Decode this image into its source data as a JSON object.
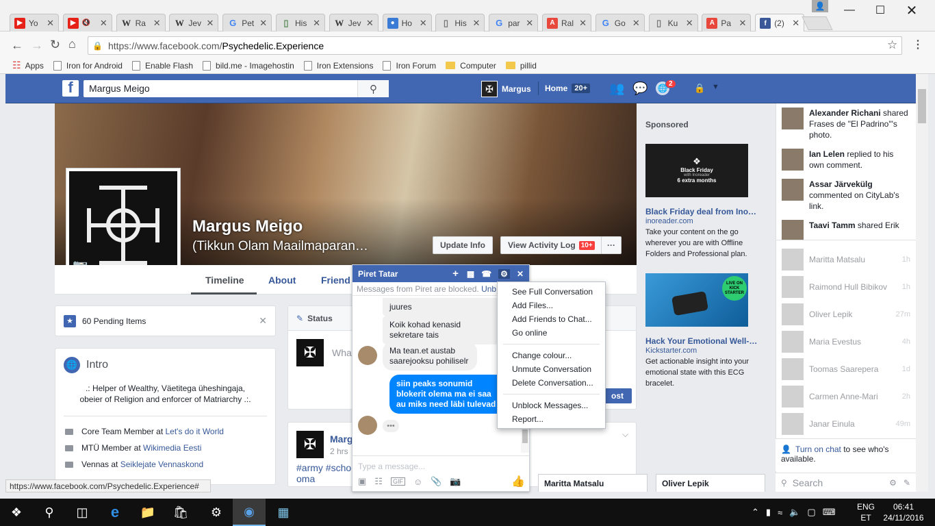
{
  "browser": {
    "tabs": [
      {
        "label": "Yo",
        "icon": "youtube-icon",
        "color": "#e62117"
      },
      {
        "label": "",
        "icon": "youtube-icon",
        "color": "#e62117",
        "muted": true
      },
      {
        "label": "Ra",
        "icon": "wikipedia-icon",
        "color": "#333333"
      },
      {
        "label": "Jev",
        "icon": "wikipedia-icon",
        "color": "#333333"
      },
      {
        "label": "Pet",
        "icon": "google-icon",
        "color": "#4285f4"
      },
      {
        "label": "His",
        "icon": "page-icon",
        "color": "#5b8c5a"
      },
      {
        "label": "Jev",
        "icon": "wikipedia-icon",
        "color": "#333333"
      },
      {
        "label": "Ho",
        "icon": "globe-icon",
        "color": "#3a7bd5"
      },
      {
        "label": "His",
        "icon": "page-icon",
        "color": "#777777"
      },
      {
        "label": "par",
        "icon": "google-icon",
        "color": "#4285f4"
      },
      {
        "label": "Ral",
        "icon": "a-icon",
        "color": "#e8473c"
      },
      {
        "label": "Go",
        "icon": "google-icon",
        "color": "#4285f4"
      },
      {
        "label": "Ku",
        "icon": "page-icon",
        "color": "#777777"
      },
      {
        "label": "Pa",
        "icon": "a-icon",
        "color": "#e8473c"
      },
      {
        "label": "(2)",
        "icon": "facebook-icon",
        "color": "#3b5998",
        "active": true
      }
    ],
    "url_prefix": "https://www.facebook.com/",
    "url_path": "Psychedelic.Experience",
    "bookmarks": [
      {
        "label": "Apps",
        "type": "apps"
      },
      {
        "label": "Iron for Android",
        "type": "page"
      },
      {
        "label": "Enable Flash",
        "type": "page"
      },
      {
        "label": "bild.me - Imagehostin",
        "type": "page"
      },
      {
        "label": "Iron Extensions",
        "type": "page"
      },
      {
        "label": "Iron Forum",
        "type": "page"
      },
      {
        "label": "Computer",
        "type": "folder"
      },
      {
        "label": "pillid",
        "type": "folder"
      }
    ],
    "status_url": "https://www.facebook.com/Psychedelic.Experience#"
  },
  "fb": {
    "search_value": "Margus Meigo",
    "nav_user": "Margus",
    "nav_home": "Home",
    "nav_home_count": "20+",
    "notif_count": "2",
    "accent": "#4267b2"
  },
  "profile": {
    "name": "Margus Meigo",
    "alt_name": "(Tikkun Olam Maailmaparan…",
    "update_info": "Update Info",
    "activity_log": "View Activity Log",
    "activity_count": "10+",
    "more": "···",
    "tabs": [
      "Timeline",
      "About",
      "Friend"
    ]
  },
  "left": {
    "pending": "60 Pending Items",
    "intro_title": "Intro",
    "intro_bio": ".: Helper of Wealthy, Väetitega üheshingaja, obeier of Religion and enforcer of Matriarchy .:.",
    "facts": [
      {
        "prefix": "Core Team Member at ",
        "link": "Let's do it World"
      },
      {
        "prefix": "MTÜ Member at ",
        "link": "Wikimedia Eesti"
      },
      {
        "prefix": "Vennas at ",
        "link": "Seiklejate Vennaskond"
      }
    ]
  },
  "composer": {
    "status_tab": "Status",
    "placeholder": "What",
    "post_btn": "ost"
  },
  "post": {
    "author": "Marg",
    "time": "2 hrs",
    "tags": "#army #scho",
    "tags2": "oma"
  },
  "sponsored": {
    "heading": "Sponsored",
    "ads": [
      {
        "img_title": "Black Friday",
        "img_sub1": "with Inoreader",
        "img_sub2": "6 extra months",
        "title": "Black Friday deal from Ino…",
        "domain": "inoreader.com",
        "text": "Take your content on the go wherever you are with Offline Folders and Professional plan."
      },
      {
        "badge": "LIVE ON KICK STARTER",
        "title": "Hack Your Emotional Well-…",
        "domain": "Kickstarter.com",
        "text": "Get actionable insight into your emotional state with this ECG bracelet."
      }
    ]
  },
  "ticker": [
    {
      "name": "Alexander Richani",
      "text": " shared Frases de \"El Padrino\"'s photo."
    },
    {
      "name": "Ian Lelen",
      "text": " replied to his own comment."
    },
    {
      "name": "Assar Järvekülg",
      "text": " commented on CityLab's link."
    },
    {
      "name": "Taavi Tamm",
      "text": " shared Erik"
    }
  ],
  "contacts": [
    {
      "name": "Maritta Matsalu",
      "time": "1h"
    },
    {
      "name": "Raimond Hull Bibikov",
      "time": "1h"
    },
    {
      "name": "Oliver Lepik",
      "time": "27m"
    },
    {
      "name": "Maria Evestus",
      "time": "4h"
    },
    {
      "name": "Toomas Saarepera",
      "time": "1d"
    },
    {
      "name": "Carmen Anne-Mari",
      "time": "2h"
    },
    {
      "name": "Janar Einula",
      "time": "49m"
    }
  ],
  "chat_sidebar": {
    "turn_on": "Turn on chat",
    "turn_on_rest": " to see who's available.",
    "search_placeholder": "Search"
  },
  "chat": {
    "title": "Piret Tatar",
    "blocked_notice": "Messages from Piret are blocked.",
    "blocked_link": "Unb",
    "messages": [
      {
        "from": "them",
        "text": "juures"
      },
      {
        "from": "them",
        "text": "Koik kohad kenasid sekretare tais"
      },
      {
        "from": "them",
        "text": "Ma tean.et austab saarejooksu pohiliselr"
      },
      {
        "from": "me",
        "text": "siin peaks sonumid blokerit olema ma ei saa au miks need läbi tulevad"
      }
    ],
    "input_placeholder": "Type a message..."
  },
  "menu": {
    "group1": [
      "See Full Conversation",
      "Add Files...",
      "Add Friends to Chat...",
      "Go online"
    ],
    "group2": [
      "Change colour...",
      "Unmute Conversation",
      "Delete Conversation..."
    ],
    "group3": [
      "Unblock Messages...",
      "Report..."
    ]
  },
  "minichats": [
    "Maritta Matsalu",
    "Oliver Lepik"
  ],
  "taskbar": {
    "lang1": "ENG",
    "lang2": "ET",
    "time": "06:41",
    "date": "24/11/2016"
  }
}
